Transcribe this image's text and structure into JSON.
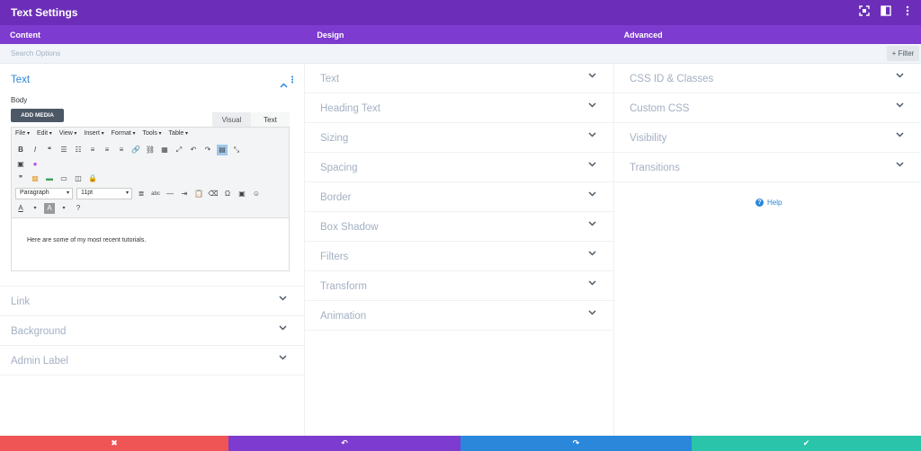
{
  "window": {
    "title": "Text Settings",
    "icons": [
      "expand-icon",
      "sidebar-icon",
      "more-icon"
    ]
  },
  "tabs": [
    {
      "label": "Content"
    },
    {
      "label": "Design"
    },
    {
      "label": "Advanced"
    }
  ],
  "search": {
    "placeholder": "Search Options",
    "filter_label": "+ Filter"
  },
  "content": {
    "text_section": {
      "label": "Text",
      "body_label": "Body",
      "add_media": "ADD MEDIA",
      "visual_tab": "Visual",
      "text_tab": "Text",
      "menu": [
        "File",
        "Edit",
        "View",
        "Insert",
        "Format",
        "Tools",
        "Table"
      ],
      "paragraph_select": "Paragraph",
      "size_select": "11pt",
      "editor_text": "Here are some of my most recent tutorials."
    },
    "sections": [
      {
        "label": "Link"
      },
      {
        "label": "Background"
      },
      {
        "label": "Admin Label"
      }
    ]
  },
  "design": {
    "sections": [
      {
        "label": "Text"
      },
      {
        "label": "Heading Text"
      },
      {
        "label": "Sizing"
      },
      {
        "label": "Spacing"
      },
      {
        "label": "Border"
      },
      {
        "label": "Box Shadow"
      },
      {
        "label": "Filters"
      },
      {
        "label": "Transform"
      },
      {
        "label": "Animation"
      }
    ]
  },
  "advanced": {
    "sections": [
      {
        "label": "CSS ID & Classes"
      },
      {
        "label": "Custom CSS"
      },
      {
        "label": "Visibility"
      },
      {
        "label": "Transitions"
      }
    ],
    "help_label": "Help"
  },
  "footer": {
    "buttons": [
      {
        "name": "discard",
        "icon": "close-icon",
        "glyph": "✖",
        "color": "#ef5555"
      },
      {
        "name": "undo",
        "icon": "undo-icon",
        "glyph": "↶",
        "color": "#7e3bd0"
      },
      {
        "name": "redo",
        "icon": "redo-icon",
        "glyph": "↷",
        "color": "#2b87da"
      },
      {
        "name": "save",
        "icon": "check-icon",
        "glyph": "✔",
        "color": "#29c4a9"
      }
    ]
  }
}
